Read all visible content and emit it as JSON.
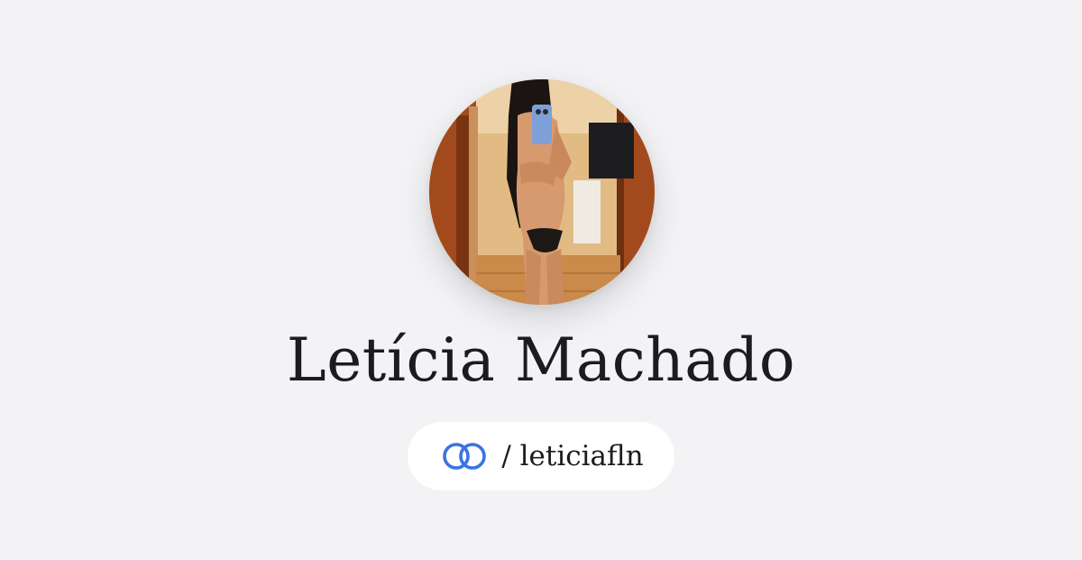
{
  "profile": {
    "name": "Letícia Machado",
    "handle": "/ leticiafln",
    "avatar_icon": "profile-photo"
  },
  "brand": {
    "logo_icon": "linked-rings-icon",
    "logo_color": "#3a74e0",
    "accent_bar_color": "#f8c3d3",
    "background_color": "#f3f3f6"
  }
}
